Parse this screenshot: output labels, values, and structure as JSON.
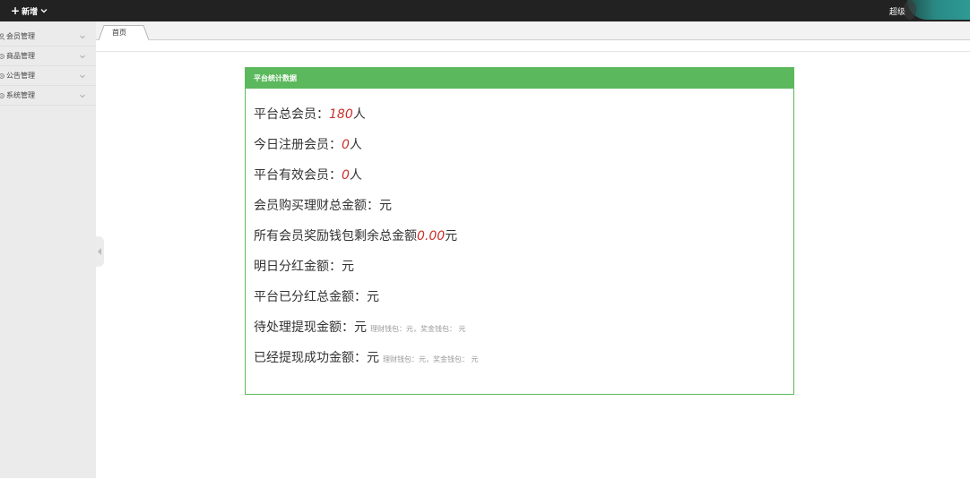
{
  "topbar": {
    "add_label": "新增",
    "user_label": "超级"
  },
  "sidebar": {
    "items": [
      {
        "label": "会员管理",
        "icon": "user-icon"
      },
      {
        "label": "商品管理",
        "icon": "gear-icon"
      },
      {
        "label": "公告管理",
        "icon": "gear-icon"
      },
      {
        "label": "系统管理",
        "icon": "gear-icon"
      }
    ]
  },
  "tabs": [
    {
      "label": "首页",
      "active": true
    }
  ],
  "panel": {
    "title": "平台统计数据",
    "rows": [
      {
        "label": "平台总会员：",
        "value": "180",
        "unit": "人",
        "note": ""
      },
      {
        "label": "今日注册会员：",
        "value": "0",
        "unit": "人",
        "note": ""
      },
      {
        "label": "平台有效会员：",
        "value": "0",
        "unit": "人",
        "note": ""
      },
      {
        "label": "会员购买理财总金额：",
        "value": "",
        "unit": "元",
        "note": ""
      },
      {
        "label": "所有会员奖励钱包剩余总金额",
        "value": "0.00",
        "unit": "元",
        "note": ""
      },
      {
        "label": "明日分红金额：",
        "value": "",
        "unit": "元",
        "note": ""
      },
      {
        "label": "平台已分红总金额：",
        "value": "",
        "unit": "元",
        "note": ""
      },
      {
        "label": "待处理提现金额：",
        "value": "",
        "unit": "元",
        "note": "理财钱包：元，奖金钱包： 元"
      },
      {
        "label": "已经提现成功金额：",
        "value": "",
        "unit": "元",
        "note": "理财钱包：元，奖金钱包： 元"
      }
    ]
  },
  "colors": {
    "topbar": "#222222",
    "sidebar": "#ebebeb",
    "panel_accent": "#5cb85c",
    "value_red": "#c9302c"
  }
}
